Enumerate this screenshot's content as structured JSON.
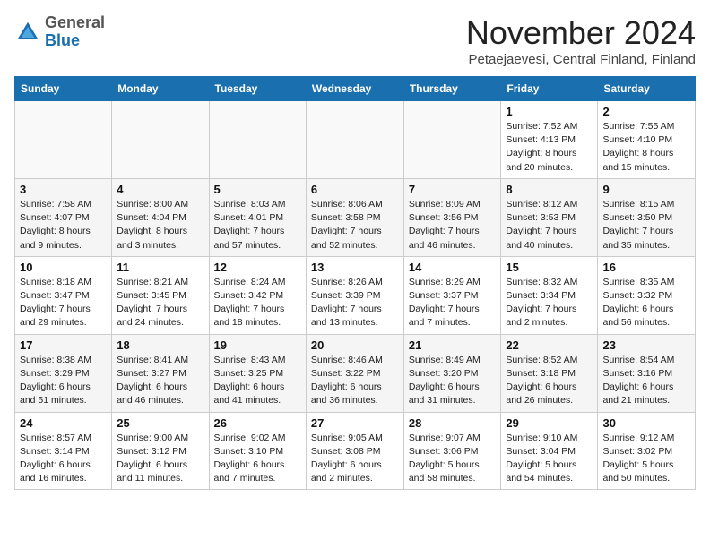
{
  "header": {
    "logo_general": "General",
    "logo_blue": "Blue",
    "month_title": "November 2024",
    "subtitle": "Petaejaevesi, Central Finland, Finland"
  },
  "weekdays": [
    "Sunday",
    "Monday",
    "Tuesday",
    "Wednesday",
    "Thursday",
    "Friday",
    "Saturday"
  ],
  "weeks": [
    [
      {
        "day": "",
        "sunrise": "",
        "sunset": "",
        "daylight": ""
      },
      {
        "day": "",
        "sunrise": "",
        "sunset": "",
        "daylight": ""
      },
      {
        "day": "",
        "sunrise": "",
        "sunset": "",
        "daylight": ""
      },
      {
        "day": "",
        "sunrise": "",
        "sunset": "",
        "daylight": ""
      },
      {
        "day": "",
        "sunrise": "",
        "sunset": "",
        "daylight": ""
      },
      {
        "day": "1",
        "sunrise": "Sunrise: 7:52 AM",
        "sunset": "Sunset: 4:13 PM",
        "daylight": "Daylight: 8 hours and 20 minutes."
      },
      {
        "day": "2",
        "sunrise": "Sunrise: 7:55 AM",
        "sunset": "Sunset: 4:10 PM",
        "daylight": "Daylight: 8 hours and 15 minutes."
      }
    ],
    [
      {
        "day": "3",
        "sunrise": "Sunrise: 7:58 AM",
        "sunset": "Sunset: 4:07 PM",
        "daylight": "Daylight: 8 hours and 9 minutes."
      },
      {
        "day": "4",
        "sunrise": "Sunrise: 8:00 AM",
        "sunset": "Sunset: 4:04 PM",
        "daylight": "Daylight: 8 hours and 3 minutes."
      },
      {
        "day": "5",
        "sunrise": "Sunrise: 8:03 AM",
        "sunset": "Sunset: 4:01 PM",
        "daylight": "Daylight: 7 hours and 57 minutes."
      },
      {
        "day": "6",
        "sunrise": "Sunrise: 8:06 AM",
        "sunset": "Sunset: 3:58 PM",
        "daylight": "Daylight: 7 hours and 52 minutes."
      },
      {
        "day": "7",
        "sunrise": "Sunrise: 8:09 AM",
        "sunset": "Sunset: 3:56 PM",
        "daylight": "Daylight: 7 hours and 46 minutes."
      },
      {
        "day": "8",
        "sunrise": "Sunrise: 8:12 AM",
        "sunset": "Sunset: 3:53 PM",
        "daylight": "Daylight: 7 hours and 40 minutes."
      },
      {
        "day": "9",
        "sunrise": "Sunrise: 8:15 AM",
        "sunset": "Sunset: 3:50 PM",
        "daylight": "Daylight: 7 hours and 35 minutes."
      }
    ],
    [
      {
        "day": "10",
        "sunrise": "Sunrise: 8:18 AM",
        "sunset": "Sunset: 3:47 PM",
        "daylight": "Daylight: 7 hours and 29 minutes."
      },
      {
        "day": "11",
        "sunrise": "Sunrise: 8:21 AM",
        "sunset": "Sunset: 3:45 PM",
        "daylight": "Daylight: 7 hours and 24 minutes."
      },
      {
        "day": "12",
        "sunrise": "Sunrise: 8:24 AM",
        "sunset": "Sunset: 3:42 PM",
        "daylight": "Daylight: 7 hours and 18 minutes."
      },
      {
        "day": "13",
        "sunrise": "Sunrise: 8:26 AM",
        "sunset": "Sunset: 3:39 PM",
        "daylight": "Daylight: 7 hours and 13 minutes."
      },
      {
        "day": "14",
        "sunrise": "Sunrise: 8:29 AM",
        "sunset": "Sunset: 3:37 PM",
        "daylight": "Daylight: 7 hours and 7 minutes."
      },
      {
        "day": "15",
        "sunrise": "Sunrise: 8:32 AM",
        "sunset": "Sunset: 3:34 PM",
        "daylight": "Daylight: 7 hours and 2 minutes."
      },
      {
        "day": "16",
        "sunrise": "Sunrise: 8:35 AM",
        "sunset": "Sunset: 3:32 PM",
        "daylight": "Daylight: 6 hours and 56 minutes."
      }
    ],
    [
      {
        "day": "17",
        "sunrise": "Sunrise: 8:38 AM",
        "sunset": "Sunset: 3:29 PM",
        "daylight": "Daylight: 6 hours and 51 minutes."
      },
      {
        "day": "18",
        "sunrise": "Sunrise: 8:41 AM",
        "sunset": "Sunset: 3:27 PM",
        "daylight": "Daylight: 6 hours and 46 minutes."
      },
      {
        "day": "19",
        "sunrise": "Sunrise: 8:43 AM",
        "sunset": "Sunset: 3:25 PM",
        "daylight": "Daylight: 6 hours and 41 minutes."
      },
      {
        "day": "20",
        "sunrise": "Sunrise: 8:46 AM",
        "sunset": "Sunset: 3:22 PM",
        "daylight": "Daylight: 6 hours and 36 minutes."
      },
      {
        "day": "21",
        "sunrise": "Sunrise: 8:49 AM",
        "sunset": "Sunset: 3:20 PM",
        "daylight": "Daylight: 6 hours and 31 minutes."
      },
      {
        "day": "22",
        "sunrise": "Sunrise: 8:52 AM",
        "sunset": "Sunset: 3:18 PM",
        "daylight": "Daylight: 6 hours and 26 minutes."
      },
      {
        "day": "23",
        "sunrise": "Sunrise: 8:54 AM",
        "sunset": "Sunset: 3:16 PM",
        "daylight": "Daylight: 6 hours and 21 minutes."
      }
    ],
    [
      {
        "day": "24",
        "sunrise": "Sunrise: 8:57 AM",
        "sunset": "Sunset: 3:14 PM",
        "daylight": "Daylight: 6 hours and 16 minutes."
      },
      {
        "day": "25",
        "sunrise": "Sunrise: 9:00 AM",
        "sunset": "Sunset: 3:12 PM",
        "daylight": "Daylight: 6 hours and 11 minutes."
      },
      {
        "day": "26",
        "sunrise": "Sunrise: 9:02 AM",
        "sunset": "Sunset: 3:10 PM",
        "daylight": "Daylight: 6 hours and 7 minutes."
      },
      {
        "day": "27",
        "sunrise": "Sunrise: 9:05 AM",
        "sunset": "Sunset: 3:08 PM",
        "daylight": "Daylight: 6 hours and 2 minutes."
      },
      {
        "day": "28",
        "sunrise": "Sunrise: 9:07 AM",
        "sunset": "Sunset: 3:06 PM",
        "daylight": "Daylight: 5 hours and 58 minutes."
      },
      {
        "day": "29",
        "sunrise": "Sunrise: 9:10 AM",
        "sunset": "Sunset: 3:04 PM",
        "daylight": "Daylight: 5 hours and 54 minutes."
      },
      {
        "day": "30",
        "sunrise": "Sunrise: 9:12 AM",
        "sunset": "Sunset: 3:02 PM",
        "daylight": "Daylight: 5 hours and 50 minutes."
      }
    ]
  ]
}
